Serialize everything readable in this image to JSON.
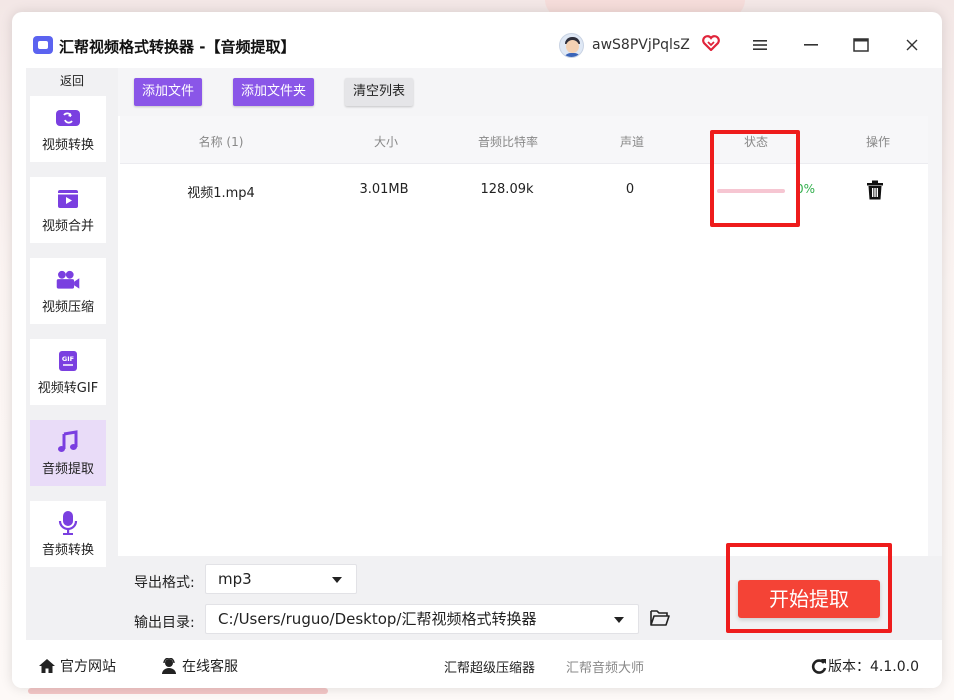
{
  "window": {
    "title": "汇帮视频格式转换器 -【音频提取】",
    "username": "awS8PVjPqlsZ"
  },
  "sidebar": {
    "back_label": "返回",
    "items": [
      {
        "label": "视频转换",
        "icon": "video-convert-icon"
      },
      {
        "label": "视频合并",
        "icon": "video-merge-icon"
      },
      {
        "label": "视频压缩",
        "icon": "video-compress-icon"
      },
      {
        "label": "视频转GIF",
        "icon": "gif-icon"
      },
      {
        "label": "音频提取",
        "icon": "music-note-icon",
        "active": true
      },
      {
        "label": "音频转换",
        "icon": "microphone-icon"
      }
    ]
  },
  "toolbar": {
    "add_file": "添加文件",
    "add_folder": "添加文件夹",
    "clear_list": "清空列表"
  },
  "table": {
    "headers": [
      "名称 (1)",
      "大小",
      "音频比特率",
      "声道",
      "状态",
      "操作"
    ],
    "rows": [
      {
        "name": "视频1.mp4",
        "size": "3.01MB",
        "bitrate": "128.09k",
        "channels": "0",
        "status": "0%",
        "progress": 0
      }
    ]
  },
  "settings": {
    "format_label": "导出格式:",
    "format_value": "mp3",
    "dir_label": "输出目录:",
    "dir_value": "C:/Users/ruguo/Desktop/汇帮视频格式转换器",
    "start_button": "开始提取"
  },
  "footer": {
    "website": "官方网站",
    "support": "在线客服",
    "link1": "汇帮超级压缩器",
    "link2": "汇帮音频大师",
    "version": "版本：4.1.0.0"
  },
  "colors": {
    "accent": "#8a56e8",
    "start": "#f44336",
    "annotation": "#ee1c1c",
    "progress_text": "#2fae4a"
  }
}
